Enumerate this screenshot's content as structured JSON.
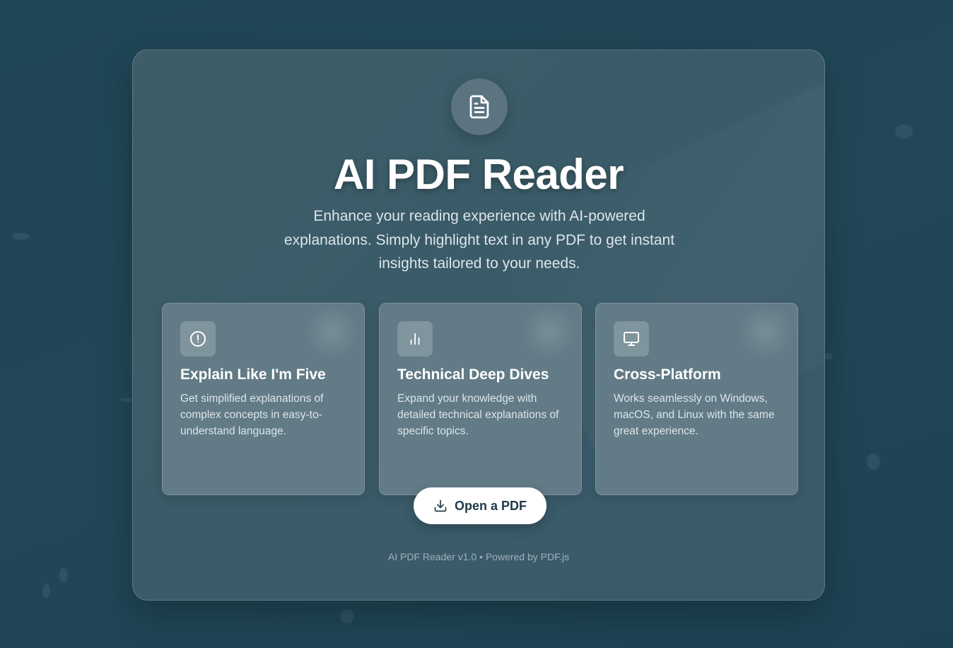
{
  "app": {
    "title": "AI PDF Reader",
    "subtitle": "Enhance your reading experience with AI-powered explanations. Simply highlight text in any PDF to get instant insights tailored to your needs.",
    "logo_icon": "document-icon"
  },
  "features": [
    {
      "icon": "info-circle-icon",
      "title": "Explain Like I'm Five",
      "description": "Get simplified explanations of complex concepts in easy-to-understand language."
    },
    {
      "icon": "bar-chart-icon",
      "title": "Technical Deep Dives",
      "description": "Expand your knowledge with detailed technical explanations of specific topics."
    },
    {
      "icon": "monitor-icon",
      "title": "Cross-Platform",
      "description": "Works seamlessly on Windows, macOS, and Linux with the same great experience."
    }
  ],
  "actions": {
    "open_label": "Open a PDF",
    "open_icon": "download-icon"
  },
  "footer": {
    "text": "AI PDF Reader v1.0 • Powered by PDF.js"
  },
  "colors": {
    "background": "#224757",
    "card": "#3b5b67",
    "feature_card": "#627b86",
    "button": "#ffffff",
    "button_text": "#1e3a48"
  }
}
